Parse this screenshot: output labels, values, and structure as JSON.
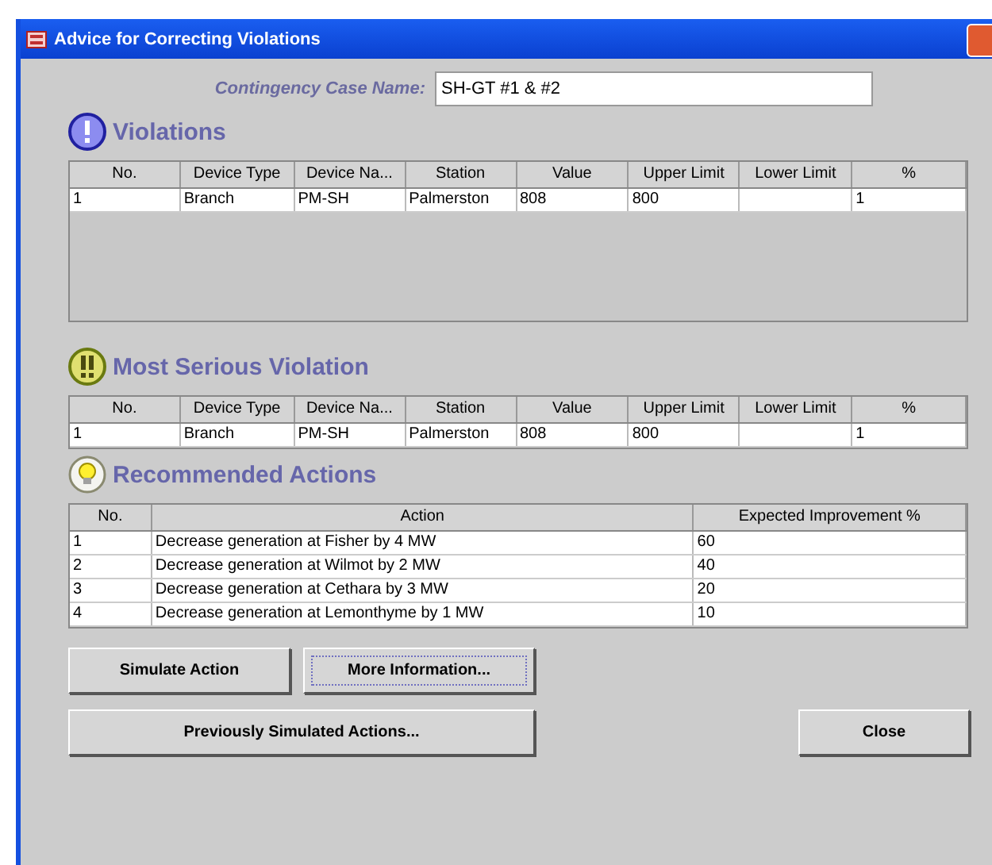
{
  "window": {
    "title": "Advice for Correcting Violations"
  },
  "case_name": {
    "label": "Contingency Case Name:",
    "value": "SH-GT #1 & #2"
  },
  "violations": {
    "heading": "Violations",
    "kind": "exclamation",
    "columns": [
      "No.",
      "Device Type",
      "Device Na...",
      "Station",
      "Value",
      "Upper Limit",
      "Lower Limit",
      "%"
    ],
    "rows": [
      [
        "1",
        "Branch",
        "PM-SH",
        "Palmerston",
        "808",
        "800",
        "",
        "1"
      ]
    ]
  },
  "most_serious": {
    "heading": "Most Serious Violation",
    "kind": "double-exclamation",
    "columns": [
      "No.",
      "Device Type",
      "Device Na...",
      "Station",
      "Value",
      "Upper Limit",
      "Lower Limit",
      "%"
    ],
    "rows": [
      [
        "1",
        "Branch",
        "PM-SH",
        "Palmerston",
        "808",
        "800",
        "",
        "1"
      ]
    ]
  },
  "recommended": {
    "heading": "Recommended Actions",
    "kind": "bulb",
    "columns": [
      "No.",
      "Action",
      "Expected Improvement %"
    ],
    "rows": [
      [
        "1",
        "Decrease generation at Fisher by 4 MW",
        "60"
      ],
      [
        "2",
        "Decrease generation at Wilmot by 2 MW",
        "40"
      ],
      [
        "3",
        "Decrease generation at Cethara by 3 MW",
        "20"
      ],
      [
        "4",
        "Decrease generation at Lemonthyme by 1 MW",
        "10"
      ]
    ]
  },
  "buttons": [
    {
      "label": "Simulate Action",
      "focused": false
    },
    {
      "label": "More Information...",
      "focused": true
    },
    {
      "label": "Previously Simulated Actions...",
      "focused": false
    },
    {
      "label": "Close",
      "focused": false
    }
  ]
}
